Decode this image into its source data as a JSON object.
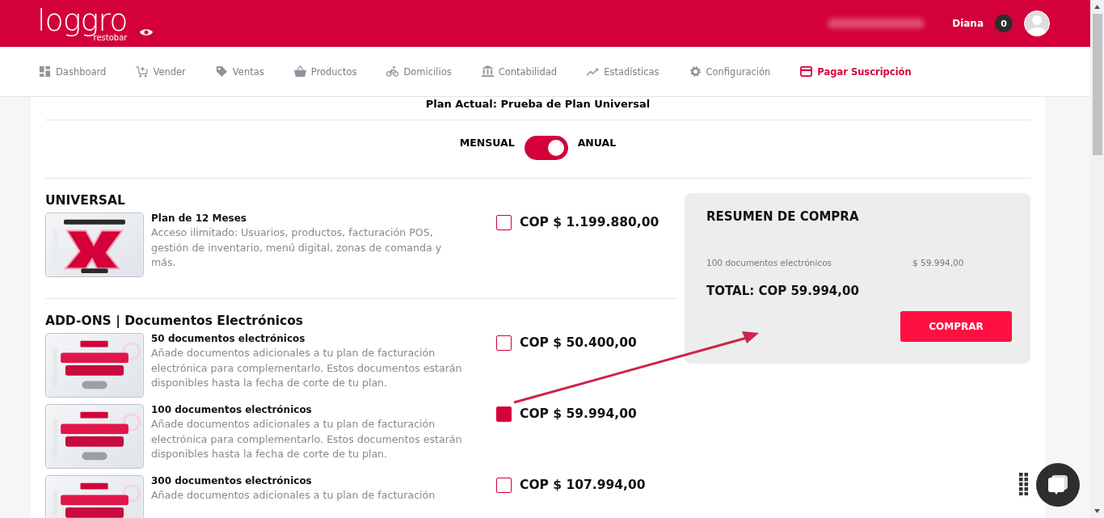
{
  "header": {
    "brand": "loggro",
    "brand_sub": "restobar",
    "user": "Diana",
    "notifications": "0"
  },
  "nav": [
    {
      "label": "Dashboard",
      "selected": false
    },
    {
      "label": "Vender",
      "selected": false
    },
    {
      "label": "Ventas",
      "selected": false
    },
    {
      "label": "Productos",
      "selected": false
    },
    {
      "label": "Domicilios",
      "selected": false
    },
    {
      "label": "Contabilidad",
      "selected": false
    },
    {
      "label": "Estadísticas",
      "selected": false
    },
    {
      "label": "Configuración",
      "selected": false
    },
    {
      "label": "Pagar Suscripción",
      "selected": true
    }
  ],
  "plan_title": "Plan Actual: Prueba de Plan Universal",
  "billing": {
    "left": "MENSUAL",
    "right": "ANUAL",
    "on": true
  },
  "sections": [
    {
      "title": "UNIVERSAL",
      "items": [
        {
          "title": "Plan de 12 Meses",
          "description": "Acceso ilimitado: Usuarios, productos, facturación POS, gestión de inventario, menú digital, zonas de comanda y más.",
          "price": "COP $ 1.199.880,00",
          "checked": false
        }
      ]
    },
    {
      "title": "ADD-ONS | Documentos Electrónicos",
      "items": [
        {
          "title": "50 documentos electrónicos",
          "description": "Añade documentos adicionales a tu plan de facturación electrónica para complementarlo. Estos documentos estarán disponibles hasta la fecha de corte de tu plan.",
          "price": "COP $ 50.400,00",
          "checked": false
        },
        {
          "title": "100 documentos electrónicos",
          "description": "Añade documentos adicionales a tu plan de facturación electrónica para complementarlo. Estos documentos estarán disponibles hasta la fecha de corte de tu plan.",
          "price": "COP $ 59.994,00",
          "checked": true
        },
        {
          "title": "300 documentos electrónicos",
          "description": "Añade documentos adicionales a tu plan de facturación",
          "price": "COP $ 107.994,00",
          "checked": false
        }
      ]
    }
  ],
  "summary": {
    "title": "RESUMEN DE COMPRA",
    "lines": [
      {
        "name": "100 documentos electrónicos",
        "amount": "$ 59.994,00"
      }
    ],
    "total": "TOTAL: COP 59.994,00",
    "button": "COMPRAR"
  }
}
